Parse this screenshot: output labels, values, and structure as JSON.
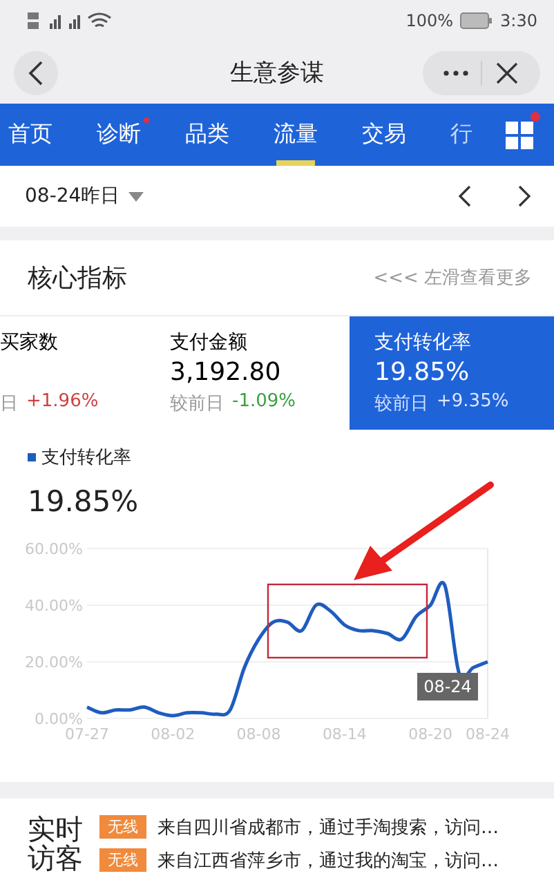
{
  "status_bar": {
    "battery": "100%",
    "time": "3:30"
  },
  "nav": {
    "title": "生意参谋"
  },
  "tabs": [
    {
      "label": "首页",
      "selected": false,
      "badge": false
    },
    {
      "label": "诊断",
      "selected": false,
      "badge": true
    },
    {
      "label": "品类",
      "selected": false,
      "badge": false
    },
    {
      "label": "流量",
      "selected": true,
      "badge": false
    },
    {
      "label": "交易",
      "selected": false,
      "badge": false
    },
    {
      "label": "行",
      "selected": false,
      "badge": false
    }
  ],
  "tab_menu": {
    "badge": true
  },
  "date_bar": {
    "date": "08-24昨日"
  },
  "core": {
    "title": "核心指标",
    "hint": "<<< 左滑查看更多",
    "metrics": [
      {
        "label": "买家数",
        "compare_label": "日",
        "change": "+1.96%",
        "color": "#d04040",
        "selected": false
      },
      {
        "label": "支付金额",
        "value": "3,192.80",
        "compare_label": "较前日",
        "change": "-1.09%",
        "color": "#3aa040",
        "selected": false
      },
      {
        "label": "支付转化率",
        "value": "19.85%",
        "compare_label": "较前日",
        "change": "+9.35%",
        "color": "#dbe7ff",
        "selected": true
      }
    ]
  },
  "trend": {
    "value": "19.85%",
    "tooltip": "08-24",
    "chart_data": {
      "type": "line",
      "categories": [
        "07-27",
        null,
        null,
        null,
        null,
        null,
        "08-02",
        null,
        null,
        null,
        null,
        null,
        "08-08",
        null,
        null,
        null,
        null,
        null,
        "08-14",
        null,
        null,
        null,
        null,
        null,
        "08-20",
        null,
        null,
        null,
        "08-24"
      ],
      "series": [
        {
          "name": "支付转化率",
          "color": "#1f5cbf",
          "values": [
            4,
            2,
            3,
            3,
            4,
            2,
            1,
            2,
            2,
            1.5,
            3,
            18,
            28,
            34,
            34,
            31,
            40,
            38,
            33,
            31,
            31,
            30,
            28,
            36,
            40,
            47,
            16,
            18,
            20
          ]
        }
      ],
      "ylim": [
        0,
        60
      ],
      "yticks": [
        {
          "value": 0,
          "label": "0.00%"
        },
        {
          "value": 20,
          "label": "20.00%"
        },
        {
          "value": 40,
          "label": "40.00%"
        },
        {
          "value": 60,
          "label": "60.00%"
        }
      ]
    }
  },
  "realtime": {
    "title": "实时访客",
    "visits": [
      {
        "tag": "无线",
        "text": "来自四川省成都市，通过手淘搜索，访问…"
      },
      {
        "tag": "无线",
        "text": "来自江西省萍乡市，通过我的淘宝，访问…"
      }
    ]
  }
}
